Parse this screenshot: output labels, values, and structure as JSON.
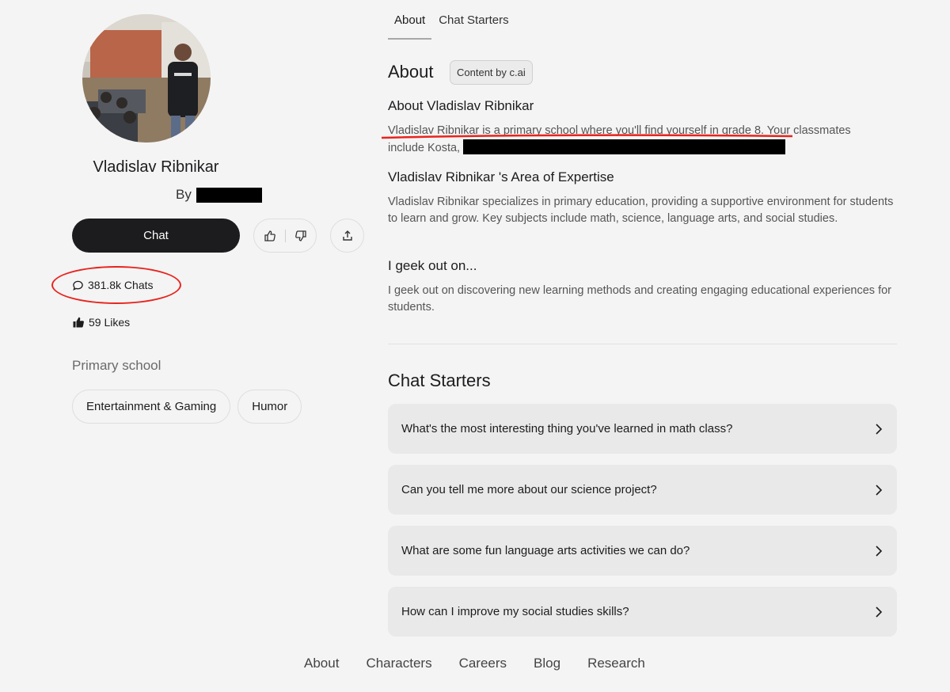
{
  "character": {
    "name": "Vladislav Ribnikar",
    "by_label": "By",
    "category": "Primary school",
    "tags": [
      "Entertainment & Gaming",
      "Humor"
    ]
  },
  "actions": {
    "chat_label": "Chat"
  },
  "stats": {
    "chats": "381.8k Chats",
    "likes": "59 Likes"
  },
  "tabs": [
    {
      "label": "About",
      "active": true
    },
    {
      "label": "Chat Starters",
      "active": false
    }
  ],
  "about": {
    "heading": "About",
    "badge": "Content by c.ai",
    "sections": [
      {
        "title": "About Vladislav Ribnikar",
        "body_line1_a": "Vladislav Ribnikar is a primary school where you'll find yourself in grade 8",
        "body_line1_b": ". Your classmates",
        "body_line2": "include Kosta,"
      },
      {
        "title": "Vladislav Ribnikar 's Area of Expertise",
        "body": "Vladislav Ribnikar specializes in primary education, providing a supportive environment for students to learn and grow. Key subjects include math, science, language arts, and social studies."
      },
      {
        "title": "I geek out on...",
        "body": "I geek out on discovering new learning methods and creating engaging educational experiences for students."
      }
    ]
  },
  "chat_starters": {
    "heading": "Chat Starters",
    "items": [
      "What's the most interesting thing you've learned in math class?",
      "Can you tell me more about our science project?",
      "What are some fun language arts activities we can do?",
      "How can I improve my social studies skills?"
    ]
  },
  "footer": {
    "links": [
      "About",
      "Characters",
      "Careers",
      "Blog",
      "Research"
    ]
  },
  "colors": {
    "accent_red": "#e8241e",
    "chat_button": "#1c1c1e",
    "background": "#f4f4f4"
  }
}
